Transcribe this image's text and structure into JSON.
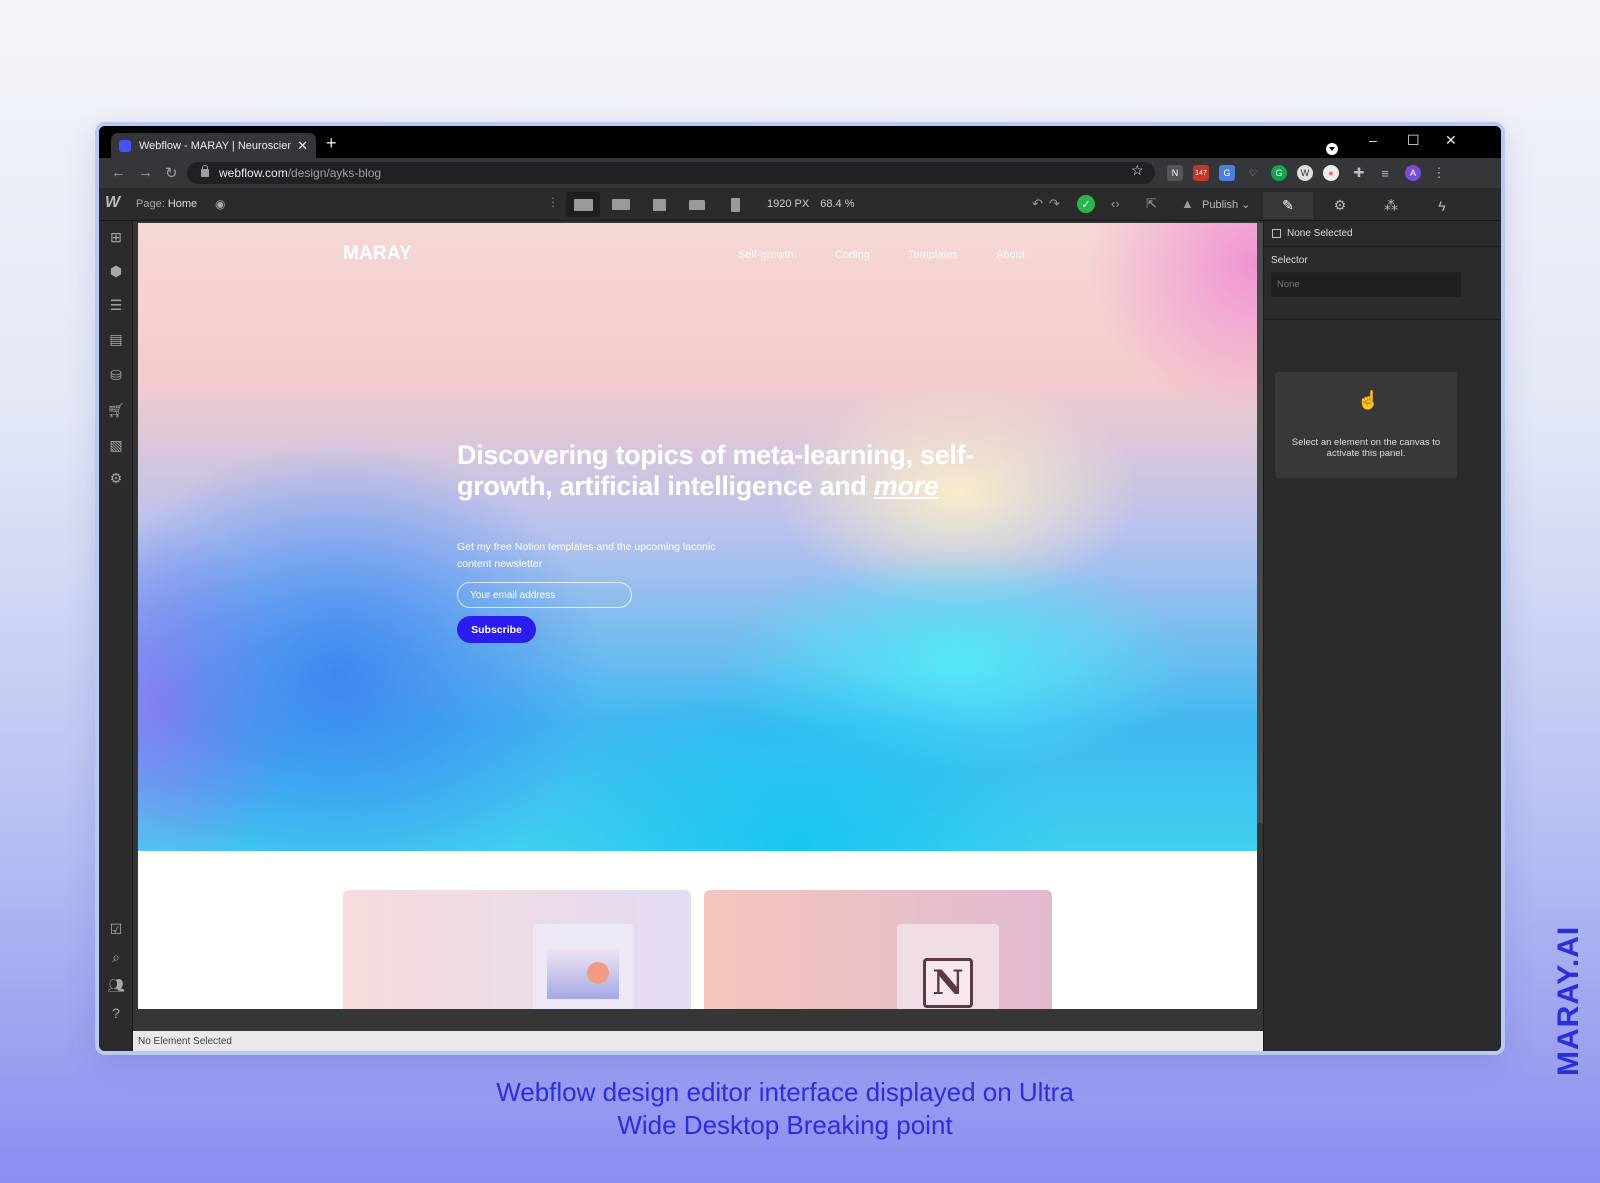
{
  "browser": {
    "tab_title": "Webflow - MARAY | Neuroscienc",
    "tab_close": "✕",
    "new_tab": "+",
    "url_host": "webflow.com",
    "url_path": "/design/ayks-blog",
    "extension_badge": "147",
    "profile_initial": "A",
    "win_min": "–",
    "win_max": "☐",
    "win_close": "✕"
  },
  "webflow": {
    "page_label": "Page:",
    "page_name": "Home",
    "viewport_width": "1920 PX",
    "zoom": "68.4 %",
    "publish_label": "Publish",
    "status_text": "No Element Selected"
  },
  "right_panel": {
    "none_selected": "None Selected",
    "selector_label": "Selector",
    "selector_placeholder": "None",
    "hint_text": "Select an element on the canvas to activate this panel."
  },
  "site": {
    "logo": "MARAY",
    "nav": [
      "Self-growth",
      "Coding",
      "Templates",
      "About"
    ],
    "headline_main": "Discovering topics of meta-learning, self-growth, artificial intelligence and ",
    "headline_em": "more",
    "subtext": "Get my free Notion templates and the upcoming laconic content newsletter",
    "email_placeholder": "Your email address",
    "subscribe_label": "Subscribe",
    "notion_letter": "N"
  },
  "outer": {
    "caption": "Webflow design editor interface displayed on Ultra Wide Desktop Breaking point",
    "brand_vertical": "MARAY.AI"
  },
  "colors": {
    "subscribe_button": "#2c1cee",
    "caption_text": "#2d2ddd",
    "check_green": "#2bb54d"
  },
  "icons": [
    "back-icon",
    "forward-icon",
    "reload-icon",
    "lock-icon",
    "star-icon",
    "eye-icon",
    "undo-icon",
    "redo-icon",
    "check-icon",
    "code-icon",
    "export-icon",
    "brush-icon",
    "gear-icon",
    "drops-icon",
    "bolt-icon",
    "pointer-hand-icon"
  ]
}
